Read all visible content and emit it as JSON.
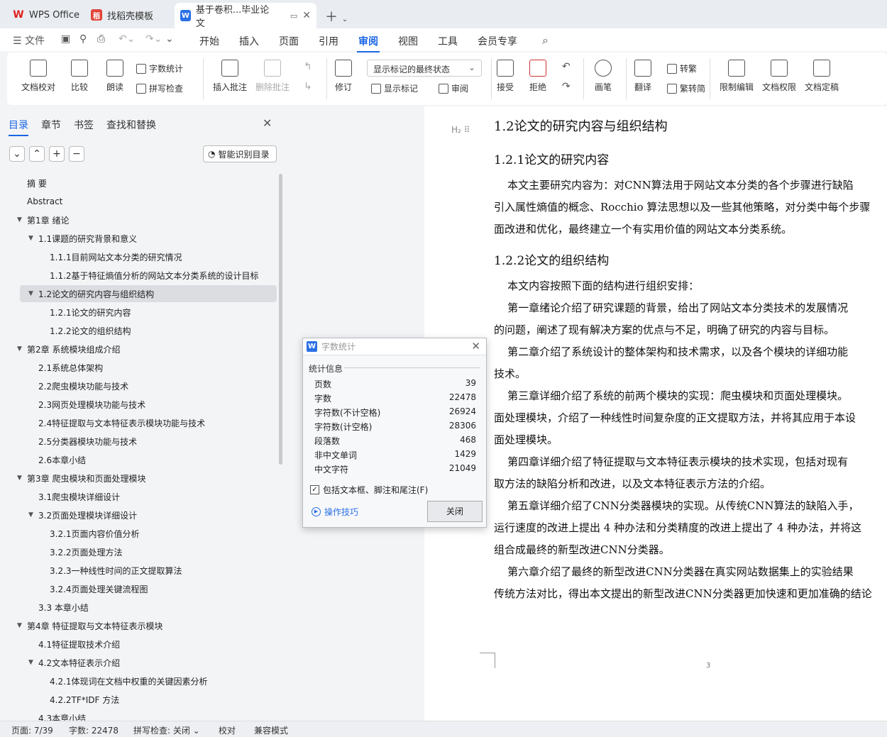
{
  "tabs": [
    {
      "label": "WPS Office",
      "icon": "wps-logo-icon",
      "color": "#e02020"
    },
    {
      "label": "找稻壳模板",
      "icon": "docer-icon",
      "color": "#e0443a"
    },
    {
      "label": "基于卷积...毕业论文",
      "icon": "writer-icon",
      "color": "#2b6fe6"
    }
  ],
  "menu": {
    "file": "文件",
    "items": [
      "开始",
      "插入",
      "页面",
      "引用",
      "审阅",
      "视图",
      "工具",
      "会员专享"
    ],
    "active": "审阅"
  },
  "ribbon": {
    "proofread": "文档校对",
    "compare": "比较",
    "read": "朗读",
    "wordcount": "字数统计",
    "spell": "拼写检查",
    "insert_comment": "插入批注",
    "delete_comment": "删除批注",
    "revise": "修订",
    "markup_dropdown": "显示标记的最终状态",
    "show_markup": "显示标记",
    "review_pane": "审阅",
    "accept": "接受",
    "reject": "拒绝",
    "pen": "画笔",
    "translate": "翻译",
    "to_trad": "转繁",
    "to_simp": "繁转简",
    "restrict": "限制编辑",
    "permission": "文档权限",
    "finalize": "文档定稿"
  },
  "nav": {
    "tabs": [
      "目录",
      "章节",
      "书签",
      "查找和替换"
    ],
    "smart": "智能识别目录"
  },
  "toc": [
    {
      "t": "摘  要",
      "lvl": 1,
      "ar": ""
    },
    {
      "t": "Abstract",
      "lvl": 1,
      "ar": ""
    },
    {
      "t": "第1章  绪论",
      "lvl": 1,
      "ar": "▼"
    },
    {
      "t": "1.1课题的研究背景和意义",
      "lvl": 2,
      "ar": "▼"
    },
    {
      "t": "1.1.1目前网站文本分类的研究情况",
      "lvl": 3,
      "ar": ""
    },
    {
      "t": "1.1.2基于特征熵值分析的网站文本分类系统的设计目标",
      "lvl": 3,
      "ar": ""
    },
    {
      "t": "1.2论文的研究内容与组织结构",
      "lvl": 2,
      "ar": "▼",
      "sel": true
    },
    {
      "t": "1.2.1论文的研究内容",
      "lvl": 3,
      "ar": ""
    },
    {
      "t": "1.2.2论文的组织结构",
      "lvl": 3,
      "ar": ""
    },
    {
      "t": "第2章  系统模块组成介绍",
      "lvl": 1,
      "ar": "▼"
    },
    {
      "t": "2.1系统总体架构",
      "lvl": 2,
      "ar": ""
    },
    {
      "t": "2.2爬虫模块功能与技术",
      "lvl": 2,
      "ar": ""
    },
    {
      "t": "2.3网页处理模块功能与技术",
      "lvl": 2,
      "ar": ""
    },
    {
      "t": "2.4特征提取与文本特征表示模块功能与技术",
      "lvl": 2,
      "ar": ""
    },
    {
      "t": "2.5分类器模块功能与技术",
      "lvl": 2,
      "ar": ""
    },
    {
      "t": "2.6本章小结",
      "lvl": 2,
      "ar": ""
    },
    {
      "t": "第3章  爬虫模块和页面处理模块",
      "lvl": 1,
      "ar": "▼"
    },
    {
      "t": "3.1爬虫模块详细设计",
      "lvl": 2,
      "ar": ""
    },
    {
      "t": "3.2页面处理模块详细设计",
      "lvl": 2,
      "ar": "▼"
    },
    {
      "t": "3.2.1页面内容价值分析",
      "lvl": 3,
      "ar": ""
    },
    {
      "t": "3.2.2页面处理方法",
      "lvl": 3,
      "ar": ""
    },
    {
      "t": "3.2.3一种线性时间的正文提取算法",
      "lvl": 3,
      "ar": ""
    },
    {
      "t": "3.2.4页面处理关键流程图",
      "lvl": 3,
      "ar": ""
    },
    {
      "t": "3.3 本章小结",
      "lvl": 2,
      "ar": ""
    },
    {
      "t": "第4章  特征提取与文本特征表示模块",
      "lvl": 1,
      "ar": "▼"
    },
    {
      "t": "4.1特征提取技术介绍",
      "lvl": 2,
      "ar": ""
    },
    {
      "t": "4.2文本特征表示介绍",
      "lvl": 2,
      "ar": "▼"
    },
    {
      "t": "4.2.1体现词在文档中权重的关键因素分析",
      "lvl": 3,
      "ar": ""
    },
    {
      "t": "4.2.2TF*IDF 方法",
      "lvl": 3,
      "ar": ""
    },
    {
      "t": "4.3本章小结",
      "lvl": 2,
      "ar": ""
    }
  ],
  "doc": {
    "h_mark": "H₂",
    "lines": [
      {
        "t": "1.2论文的研究内容与组织结构",
        "k": "h"
      },
      {
        "t": "1.2.1论文的研究内容",
        "k": "h3"
      },
      {
        "t": "    本文主要研究内容为：对CNN算法用于网站文本分类的各个步骤进行缺陷",
        "k": "p"
      },
      {
        "t": "引入属性熵值的概念、Rocchio 算法思想以及一些其他策略，对分类中每个步骤",
        "k": "p"
      },
      {
        "t": "面改进和优化，最终建立一个有实用价值的网站文本分类系统。",
        "k": "p"
      },
      {
        "t": "1.2.2论文的组织结构",
        "k": "h3"
      },
      {
        "t": "    本文内容按照下面的结构进行组织安排：",
        "k": "p"
      },
      {
        "t": "    第一章绪论介绍了研究课题的背景，给出了网站文本分类技术的发展情况",
        "k": "p"
      },
      {
        "t": "的问题，阐述了现有解决方案的优点与不足，明确了研究的内容与目标。",
        "k": "p"
      },
      {
        "t": "    第二章介绍了系统设计的整体架构和技术需求，以及各个模块的详细功能",
        "k": "p"
      },
      {
        "t": "技术。",
        "k": "p"
      },
      {
        "t": "    第三章详细介绍了系统的前两个模块的实现：爬虫模块和页面处理模块。",
        "k": "p"
      },
      {
        "t": "面处理模块，介绍了一种线性时间复杂度的正文提取方法，并将其应用于本设",
        "k": "p"
      },
      {
        "t": "面处理模块。",
        "k": "p"
      },
      {
        "t": "    第四章详细介绍了特征提取与文本特征表示模块的技术实现，包括对现有",
        "k": "p"
      },
      {
        "t": "取方法的缺陷分析和改进，以及文本特征表示方法的介绍。",
        "k": "p"
      },
      {
        "t": "    第五章详细介绍了CNN分类器模块的实现。从传统CNN算法的缺陷入手，",
        "k": "p"
      },
      {
        "t": "运行速度的改进上提出 4 种办法和分类精度的改进上提出了 4 种办法，并将这",
        "k": "p"
      },
      {
        "t": "组合成最终的新型改进CNN分类器。",
        "k": "p"
      },
      {
        "t": "    第六章介绍了最终的新型改进CNN分类器在真实网站数据集上的实验结果",
        "k": "p"
      },
      {
        "t": "传统方法对比，得出本文提出的新型改进CNN分类器更加快速和更加准确的结论",
        "k": "p"
      }
    ],
    "page_number": "3"
  },
  "dialog": {
    "title": "字数统计",
    "group": "统计信息",
    "rows": [
      {
        "label": "页数",
        "value": "39"
      },
      {
        "label": "字数",
        "value": "22478"
      },
      {
        "label": "字符数(不计空格)",
        "value": "26924"
      },
      {
        "label": "字符数(计空格)",
        "value": "28306"
      },
      {
        "label": "段落数",
        "value": "468"
      },
      {
        "label": "非中文单词",
        "value": "1429"
      },
      {
        "label": "中文字符",
        "value": "21049"
      }
    ],
    "checkbox": "包括文本框、脚注和尾注(F)",
    "tips": "操作技巧",
    "close": "关闭"
  },
  "status": {
    "page": "页面: 7/39",
    "words": "字数: 22478",
    "spell": "拼写检查: 关闭",
    "proof": "校对",
    "compat": "兼容模式"
  }
}
